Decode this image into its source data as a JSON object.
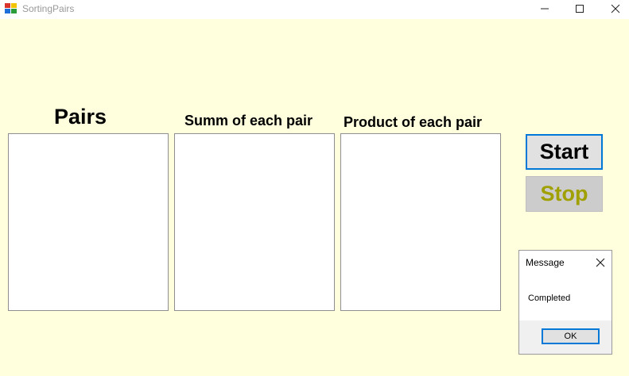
{
  "window": {
    "title": "SortingPairs"
  },
  "labels": {
    "pairs": "Pairs",
    "sum": "Summ of each pair",
    "product": "Product of each pair"
  },
  "buttons": {
    "start": "Start",
    "stop": "Stop"
  },
  "message_box": {
    "title": "Message",
    "text": "Completed",
    "ok": "OK"
  },
  "colors": {
    "client_bg": "#ffffde",
    "accent": "#0078d7",
    "stop_text": "#a0a000"
  },
  "icons": {
    "app": "app-icon",
    "minimize": "minimize-icon",
    "maximize": "maximize-icon",
    "close": "close-icon",
    "msg_close": "close-icon"
  }
}
